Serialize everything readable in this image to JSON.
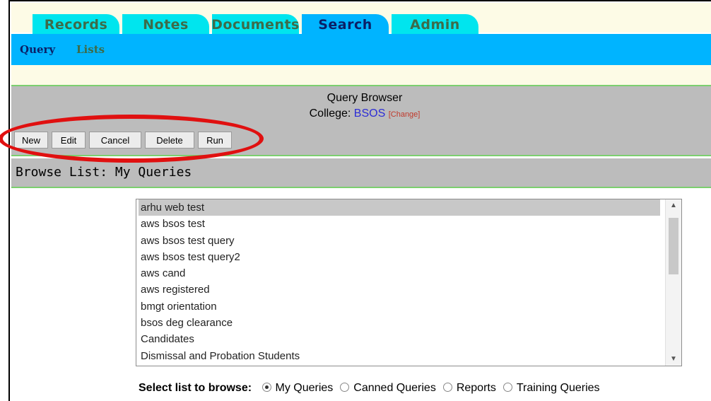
{
  "tabs": [
    {
      "label": "Records",
      "active": false
    },
    {
      "label": "Notes",
      "active": false
    },
    {
      "label": "Documents",
      "active": false
    },
    {
      "label": "Search",
      "active": true
    },
    {
      "label": "Admin",
      "active": false
    }
  ],
  "subnav": {
    "query": "Query",
    "lists": "Lists"
  },
  "query_browser": {
    "title": "Query Browser",
    "college_label": "College:",
    "college_value": "BSOS",
    "change_link": "[Change]"
  },
  "buttons": {
    "new": "New",
    "edit": "Edit",
    "cancel": "Cancel",
    "delete": "Delete",
    "run": "Run"
  },
  "browse_list": {
    "label": "Browse List: My Queries"
  },
  "list": {
    "items": [
      "arhu web test",
      "aws bsos test",
      "aws bsos test query",
      "aws bsos test query2",
      "aws cand",
      "aws registered",
      "bmgt orientation",
      "bsos deg clearance",
      "Candidates",
      "Dismissal and Probation Students"
    ],
    "selected_index": 0
  },
  "select_list": {
    "label": "Select list to browse:",
    "options": [
      "My Queries",
      "Canned Queries",
      "Reports",
      "Training Queries"
    ],
    "selected": "My Queries"
  },
  "colors": {
    "tab": "#00e5ee",
    "tab_active": "#00b4ff",
    "annotation": "#e01010"
  }
}
